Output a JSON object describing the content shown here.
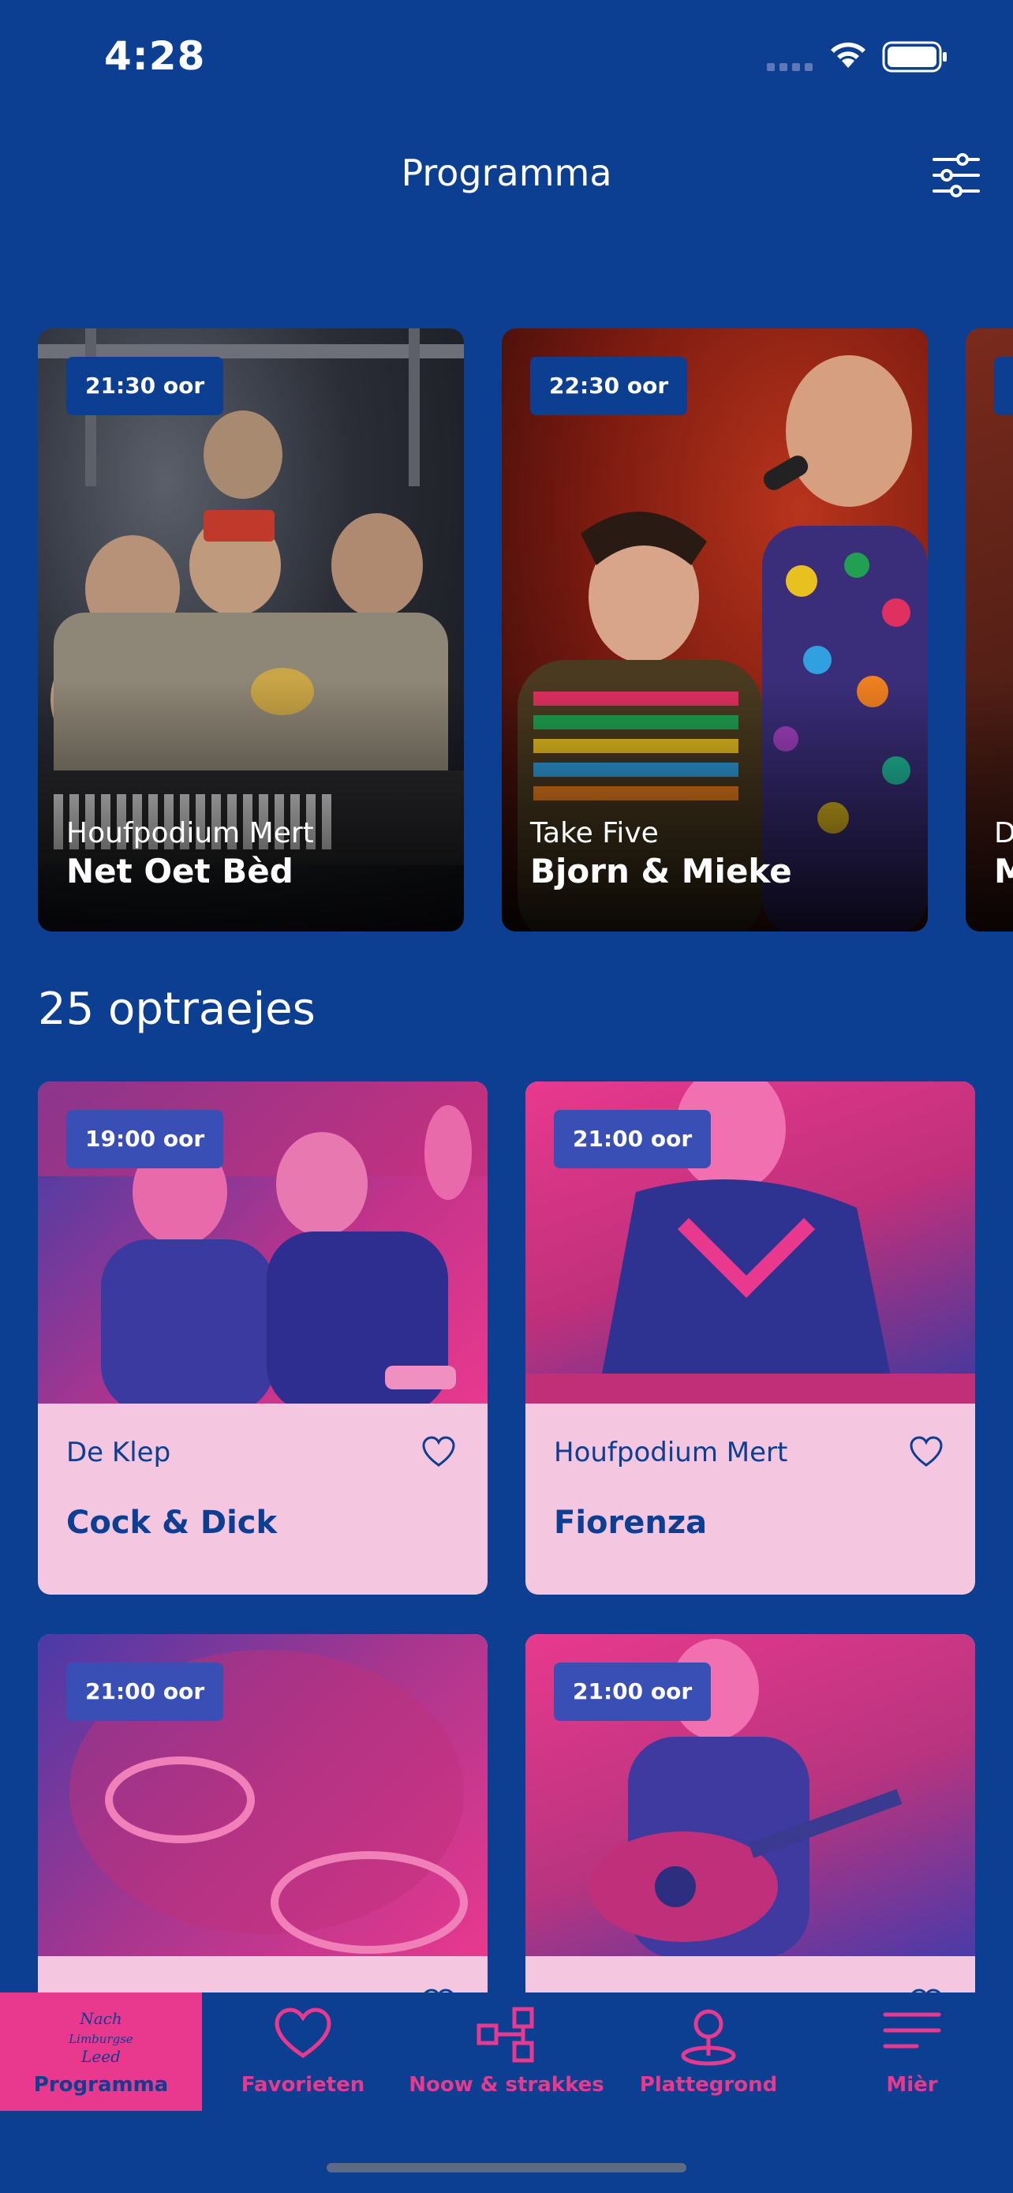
{
  "status_bar": {
    "time": "4:28"
  },
  "header": {
    "title": "Programma"
  },
  "featured": [
    {
      "time": "21:30 oor",
      "venue": "Houfpodium Mert",
      "name": "Net Oet Bèd"
    },
    {
      "time": "22:30 oor",
      "venue": "Take Five",
      "name": "Bjorn & Mieke"
    },
    {
      "time": "",
      "venue": "D",
      "name": "M"
    }
  ],
  "section": {
    "heading": "25 optraejes"
  },
  "acts": [
    {
      "time": "19:00 oor",
      "venue": "De Klep",
      "name": "Cock & Dick"
    },
    {
      "time": "21:00 oor",
      "venue": "Houfpodium Mert",
      "name": "Fiorenza"
    },
    {
      "time": "21:00 oor",
      "venue": "",
      "name": ""
    },
    {
      "time": "21:00 oor",
      "venue": "",
      "name": ""
    }
  ],
  "tabs": [
    {
      "label": "Programma",
      "icon": "festival-logo-icon",
      "active": true,
      "logo_text": "Nach Limburgse Leed"
    },
    {
      "label": "Favorieten",
      "icon": "heart-icon",
      "active": false
    },
    {
      "label": "Noow & strakkes",
      "icon": "timeline-icon",
      "active": false
    },
    {
      "label": "Plattegrond",
      "icon": "map-pin-icon",
      "active": false
    },
    {
      "label": "Mièr",
      "icon": "menu-icon",
      "active": false
    }
  ],
  "colors": {
    "background": "#0c3e92",
    "accent": "#e8398e",
    "card": "#f4c6df"
  }
}
